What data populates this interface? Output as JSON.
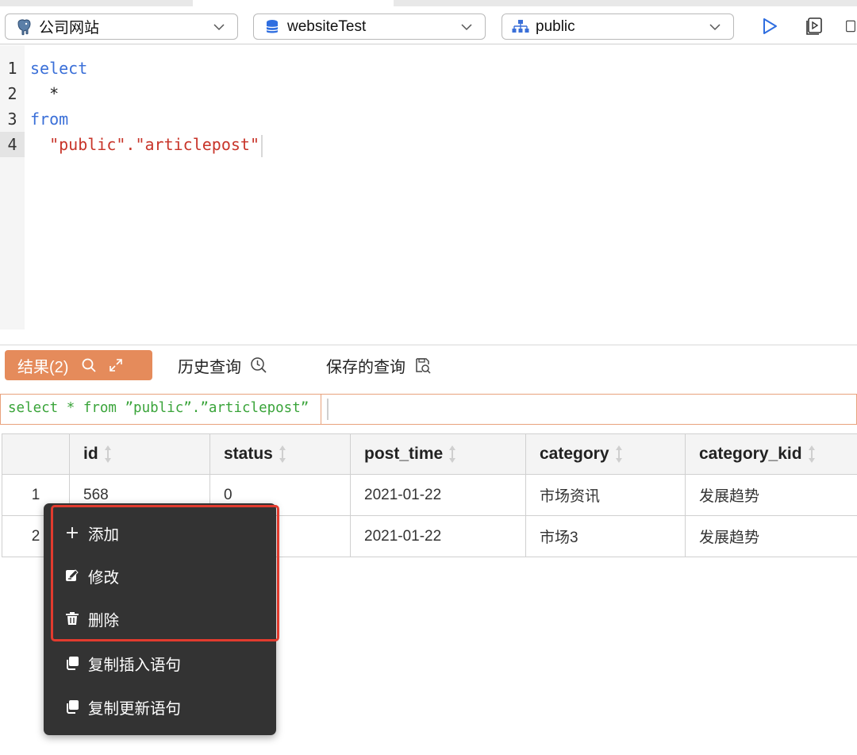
{
  "toolbar": {
    "connection": "公司网站",
    "database": "websiteTest",
    "schema": "public",
    "run_icon": "play-icon",
    "explain_icon": "run-selection-icon",
    "copy_icon": "window-icon"
  },
  "editor": {
    "lines": [
      {
        "num": "1",
        "text": "select"
      },
      {
        "num": "2",
        "text": "  *"
      },
      {
        "num": "3",
        "text": "from"
      },
      {
        "num": "4",
        "text": "  \"public\".\"articlepost\""
      }
    ]
  },
  "tabs": {
    "results": "结果(2)",
    "history": "历史查询",
    "saved": "保存的查询"
  },
  "query_bar": {
    "sql": "select * from ”public”.”articlepost”"
  },
  "table": {
    "columns": [
      "id",
      "status",
      "post_time",
      "category",
      "category_kid"
    ],
    "rows": [
      {
        "index": "1",
        "id": "568",
        "status": "0",
        "post_time": "2021-01-22",
        "category": "市场资讯",
        "category_kid": "发展趋势"
      },
      {
        "index": "2",
        "id": "",
        "status": "",
        "post_time": "2021-01-22",
        "category": "市场3",
        "category_kid": "发展趋势"
      }
    ]
  },
  "context_menu": {
    "items": [
      {
        "label": "添加",
        "icon": "plus-icon"
      },
      {
        "label": "修改",
        "icon": "edit-icon"
      },
      {
        "label": "删除",
        "icon": "trash-icon"
      },
      {
        "label": "复制插入语句",
        "icon": "copy-icon"
      },
      {
        "label": "复制更新语句",
        "icon": "copy-icon"
      }
    ]
  },
  "colors": {
    "accent": "#e58b5b",
    "keyword": "#3a6fd8",
    "string": "#c8352a",
    "query_text": "#3aa43a",
    "highlight_border": "#e23b2e",
    "menu_bg": "#333333"
  }
}
